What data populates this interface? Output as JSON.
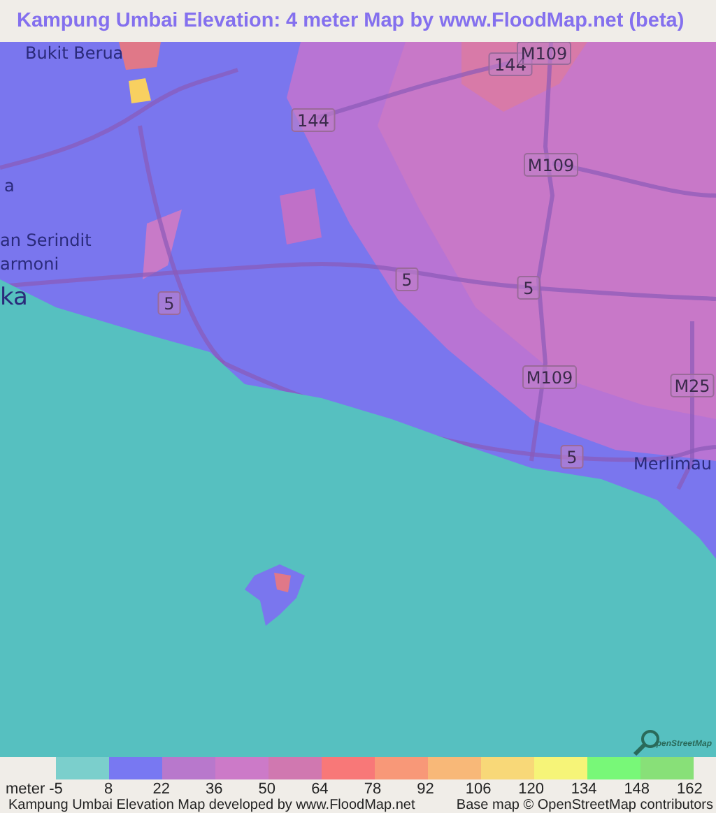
{
  "title": "Kampung Umbai Elevation: 4 meter Map by www.FloodMap.net (beta)",
  "map": {
    "labels": [
      {
        "kind": "place",
        "text": "Bukit Berua"
      },
      {
        "kind": "place",
        "text": "a"
      },
      {
        "kind": "place",
        "text": "an Serindit"
      },
      {
        "kind": "place",
        "text": "armoni"
      },
      {
        "kind": "place",
        "text": "ka"
      },
      {
        "kind": "shield",
        "text": "144"
      },
      {
        "kind": "shield",
        "text": "M109"
      },
      {
        "kind": "shield",
        "text": "144"
      },
      {
        "kind": "shield",
        "text": "M109"
      },
      {
        "kind": "shield",
        "text": "5"
      },
      {
        "kind": "shield",
        "text": "5"
      },
      {
        "kind": "shield",
        "text": "5"
      },
      {
        "kind": "shield",
        "text": "M109"
      },
      {
        "kind": "shield",
        "text": "M25"
      },
      {
        "kind": "shield",
        "text": "5"
      },
      {
        "kind": "place",
        "text": "Merlimau"
      }
    ],
    "attribution_logo": "penStreetMap"
  },
  "legend": {
    "unit": "meter",
    "swatches": [
      {
        "color": "#7bcfcc"
      },
      {
        "color": "#7878f2"
      },
      {
        "color": "#b878cc"
      },
      {
        "color": "#cc7ac8"
      },
      {
        "color": "#d078b0"
      },
      {
        "color": "#f87878"
      },
      {
        "color": "#f89878"
      },
      {
        "color": "#f8b878"
      },
      {
        "color": "#f8d878"
      },
      {
        "color": "#f6f478"
      },
      {
        "color": "#78f878"
      },
      {
        "color": "#88e078"
      }
    ],
    "ticks": [
      "-5",
      "8",
      "22",
      "36",
      "50",
      "64",
      "78",
      "92",
      "106",
      "120",
      "134",
      "148",
      "162"
    ]
  },
  "footer": {
    "left": "Kampung Umbai Elevation Map developed by www.FloodMap.net",
    "right": "Base map © OpenStreetMap contributors"
  }
}
